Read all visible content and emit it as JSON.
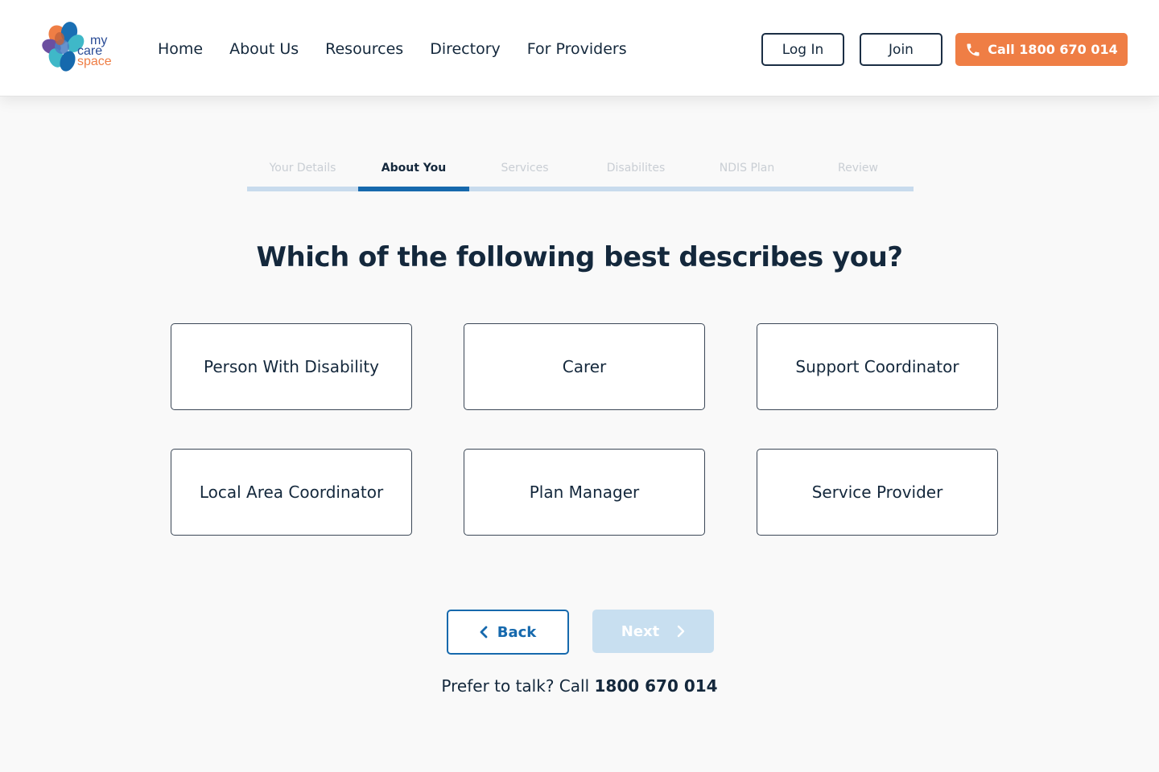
{
  "brand": {
    "line1": "my",
    "line2": "care",
    "line3": "space",
    "colors": {
      "orange": "#ef7e45",
      "blue": "#1669ad",
      "navy": "#14283c",
      "teal": "#3fb8c8",
      "purple": "#6b4fa0"
    }
  },
  "nav": {
    "items": [
      "Home",
      "About Us",
      "Resources",
      "Directory",
      "For Providers"
    ]
  },
  "header_actions": {
    "login": "Log In",
    "join": "Join",
    "call": "Call 1800 670 014",
    "call_icon": "phone-icon"
  },
  "stepper": {
    "steps": [
      "Your Details",
      "About You",
      "Services",
      "Disabilites",
      "NDIS Plan",
      "Review"
    ],
    "active_index": 1
  },
  "question": "Which of the following best describes you?",
  "options": [
    "Person With Disability",
    "Carer",
    "Support Coordinator",
    "Local Area Coordinator",
    "Plan Manager",
    "Service Provider"
  ],
  "footer_nav": {
    "back": "Back",
    "back_icon": "chevron-left-icon",
    "next": "Next",
    "next_icon": "chevron-right-icon",
    "next_disabled": true
  },
  "talk": {
    "prefix": "Prefer to talk? Call",
    "phone": "1800 670 014"
  }
}
